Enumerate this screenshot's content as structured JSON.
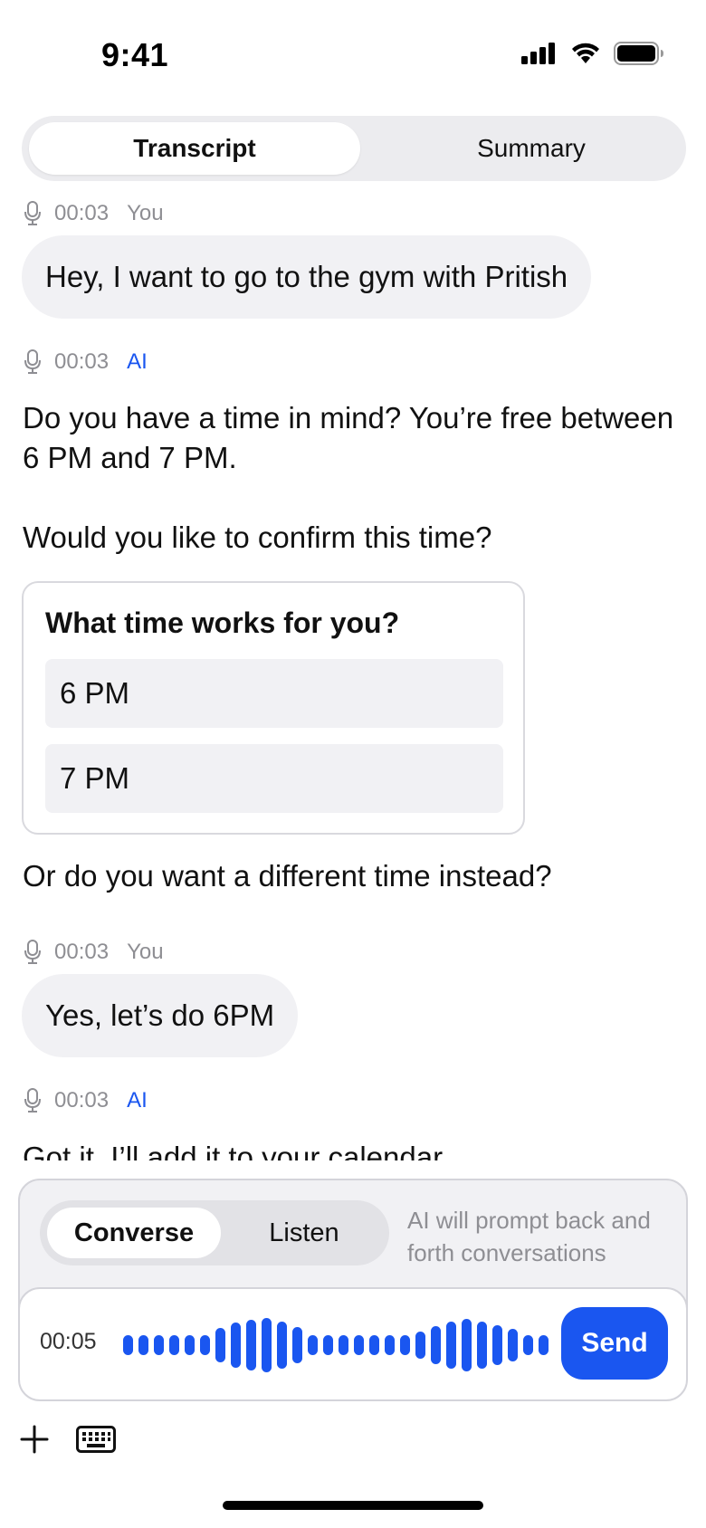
{
  "status_bar": {
    "time": "9:41"
  },
  "top_tabs": {
    "transcript": "Transcript",
    "summary": "Summary",
    "selected": "Transcript"
  },
  "messages": [
    {
      "timestamp": "00:03",
      "speaker": "You",
      "text": "Hey, I want to go to the gym with Pritish"
    },
    {
      "timestamp": "00:03",
      "speaker": "AI",
      "paragraph1": "Do you have a time in mind? You’re free between 6 PM and 7 PM.",
      "paragraph2": "Would you like to confirm this time?"
    },
    {
      "timestamp": "00:03",
      "speaker": "You",
      "text": "Yes, let’s do 6PM"
    },
    {
      "timestamp": "00:03",
      "speaker": "AI",
      "text": "Got it. I’ll add it to your calendar."
    }
  ],
  "time_choice": {
    "title": "What time works for you?",
    "options": [
      "6 PM",
      "7 PM"
    ],
    "followup": "Or do you want a different time instead?"
  },
  "composer": {
    "modes": [
      "Converse",
      "Listen"
    ],
    "selected_mode": "Converse",
    "hint": "AI will prompt back and forth conversations",
    "recording_time": "00:05",
    "send_label": "Send"
  },
  "colors": {
    "accent": "#1a56f0",
    "bubble": "#f1f1f4",
    "meta": "#8e8e93"
  },
  "icons": [
    "signal-icon",
    "wifi-icon",
    "battery-icon",
    "microphone-icon",
    "plus-icon",
    "keyboard-icon"
  ]
}
